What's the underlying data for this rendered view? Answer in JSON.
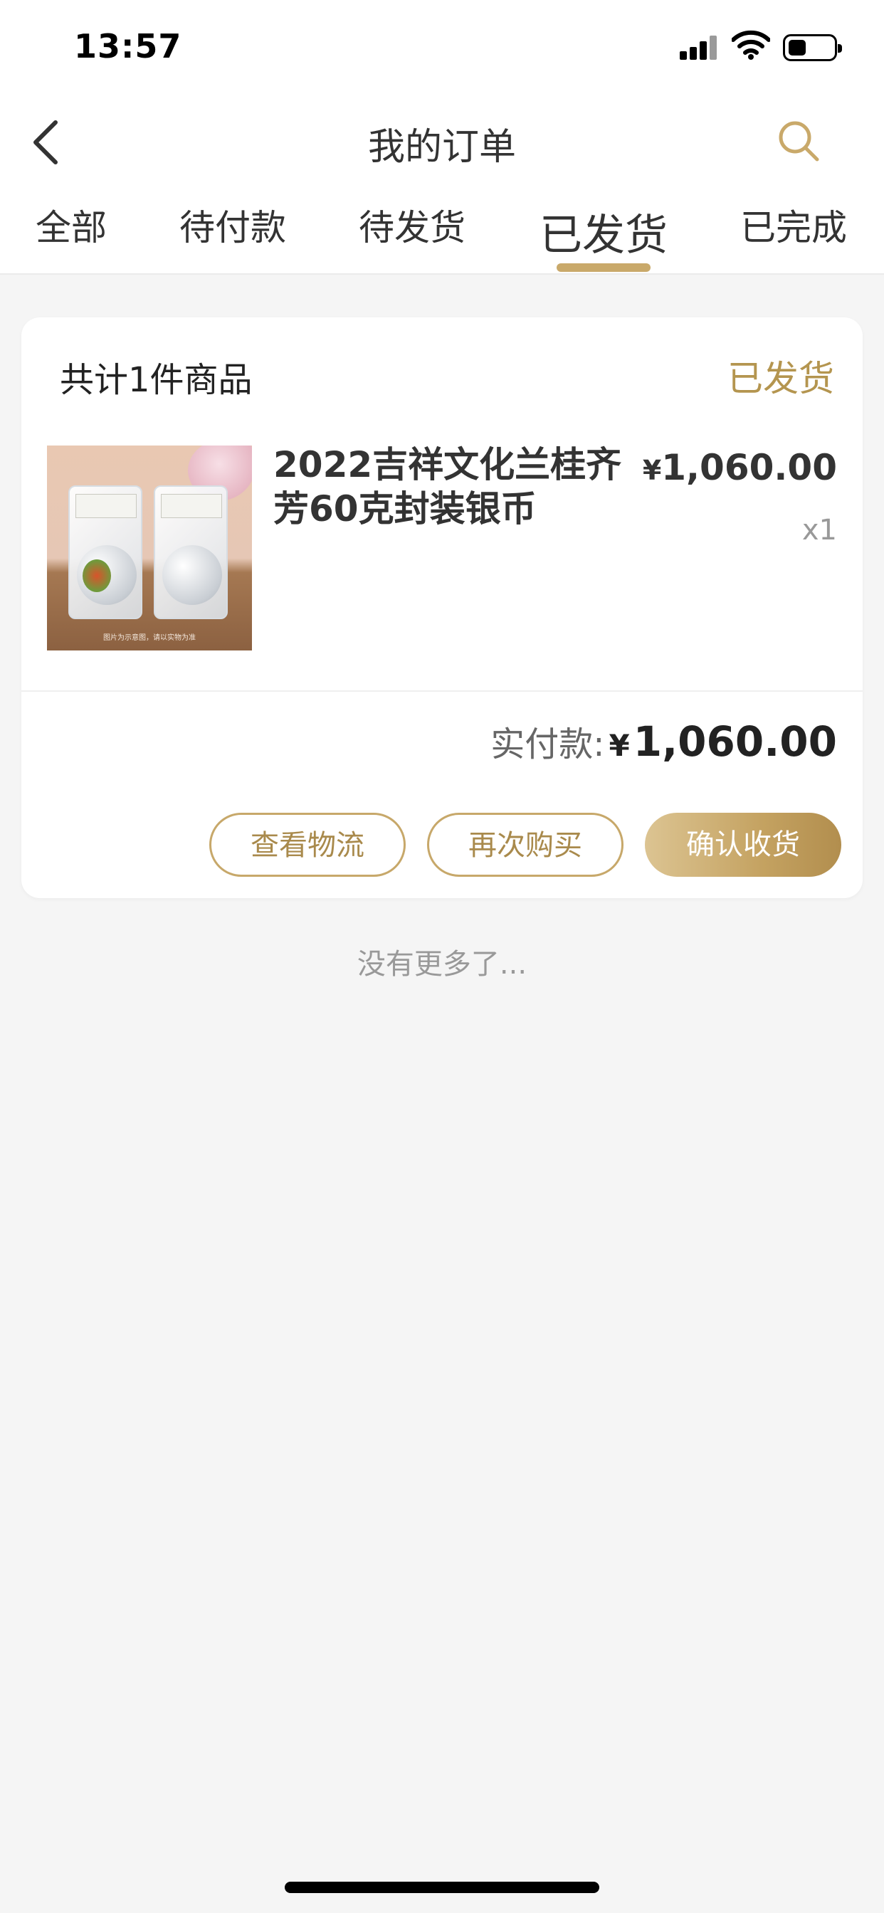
{
  "status_bar": {
    "time": "13:57",
    "icons": [
      "signal-icon",
      "wifi-icon",
      "battery-icon"
    ]
  },
  "header": {
    "title": "我的订单",
    "back_icon": "chevron-left-icon",
    "search_icon": "search-icon"
  },
  "tabs": [
    {
      "label": "全部",
      "active": false
    },
    {
      "label": "待付款",
      "active": false
    },
    {
      "label": "待发货",
      "active": false
    },
    {
      "label": "已发货",
      "active": true
    },
    {
      "label": "已完成",
      "active": false
    }
  ],
  "order": {
    "count_text": "共计1件商品",
    "status": "已发货",
    "product": {
      "name": "2022吉祥文化兰桂齐芳60克封装银币",
      "price_symbol": "¥",
      "price": "1,060.00",
      "quantity": "x1",
      "image_caption": "图片为示意图，请以实物为准"
    },
    "paid_label": "实付款:",
    "paid_symbol": "¥",
    "paid_amount": "1,060.00",
    "buttons": {
      "logistics": "查看物流",
      "rebuy": "再次购买",
      "confirm": "确认收货"
    }
  },
  "footer_text": "没有更多了...",
  "colors": {
    "accent_gold": "#c9a96a",
    "status_gold": "#b4954f",
    "background": "#f5f5f5"
  }
}
